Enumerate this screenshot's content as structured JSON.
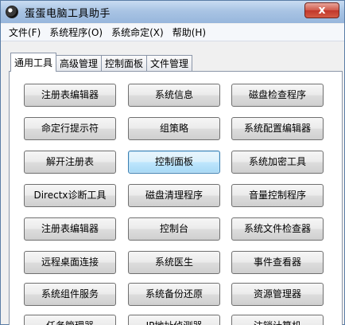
{
  "window": {
    "title": "蛋蛋电脑工具助手",
    "close_label": "x"
  },
  "menu": [
    {
      "label": "文件(F)"
    },
    {
      "label": "系统程序(O)"
    },
    {
      "label": "系统命定(X)"
    },
    {
      "label": "帮助(H)"
    }
  ],
  "tabs": [
    {
      "label": "通用工具",
      "active": true
    },
    {
      "label": "高级管理"
    },
    {
      "label": "控制面板"
    },
    {
      "label": "文件管理"
    }
  ],
  "buttons": [
    [
      "注册表编辑器",
      "系统信息",
      "磁盘检查程序"
    ],
    [
      "命定行提示符",
      "组策略",
      "系统配置编辑器"
    ],
    [
      "解开注册表",
      "控制面板",
      "系统加密工具"
    ],
    [
      "Directx诊断工具",
      "磁盘清理程序",
      "音量控制程序"
    ],
    [
      "注册表编辑器",
      "控制台",
      "系统文件检查器"
    ],
    [
      "远程桌面连接",
      "系统医生",
      "事件查看器"
    ],
    [
      "系统组件服务",
      "系统备份还原",
      "资源管理器"
    ],
    [
      "任务管理器",
      "IP地址侦测器",
      "注销计算机"
    ]
  ],
  "focused_button": "控制面板"
}
